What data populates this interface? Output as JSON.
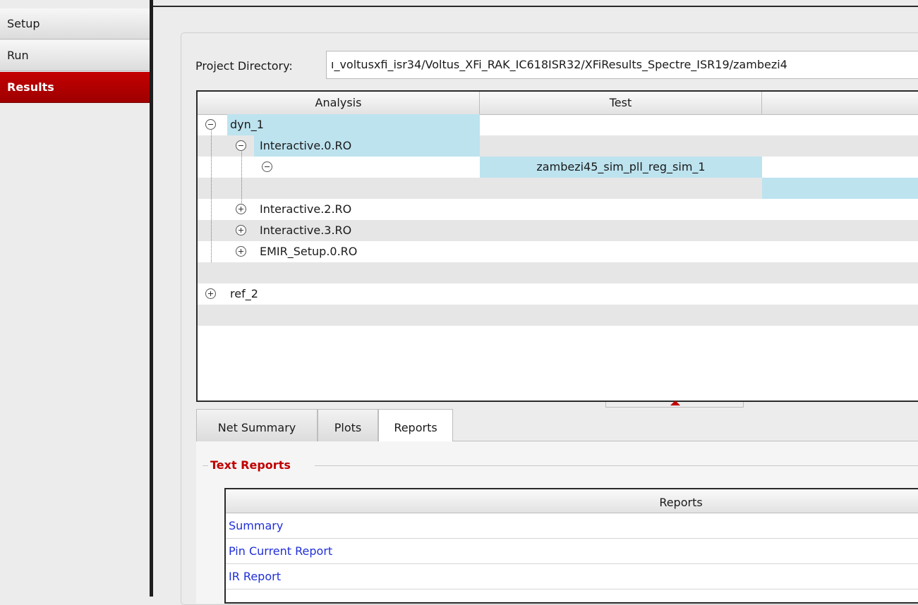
{
  "nav": {
    "items": [
      {
        "label": "Setup"
      },
      {
        "label": "Run"
      },
      {
        "label": "Results"
      }
    ],
    "active": "Results"
  },
  "project": {
    "label": "Project Directory:",
    "value": "ı_voltusxfi_isr34/Voltus_XFi_RAK_IC618ISR32/XFiResults_Spectre_ISR19/zambezi4"
  },
  "tree": {
    "columns": [
      "Analysis",
      "Test",
      ""
    ],
    "nodes": {
      "dyn_1": "dyn_1",
      "interactive_0": "Interactive.0.RO",
      "test_name": "zambezi45_sim_pll_reg_sim_1",
      "interactive_2": "Interactive.2.RO",
      "interactive_3": "Interactive.3.RO",
      "emir_setup": "EMIR_Setup.0.RO",
      "ref_2": "ref_2"
    }
  },
  "tabs": [
    {
      "label": "Net Summary"
    },
    {
      "label": "Plots"
    },
    {
      "label": "Reports"
    }
  ],
  "active_tab": "Reports",
  "text_reports": {
    "title": "Text Reports",
    "header": "Reports",
    "rows": [
      {
        "label": "Summary"
      },
      {
        "label": "Pin Current Report"
      },
      {
        "label": "IR Report"
      }
    ]
  },
  "colors": {
    "accent_red": "#c00000",
    "selection": "#bde3ef",
    "link_blue": "#1f2fd8"
  }
}
